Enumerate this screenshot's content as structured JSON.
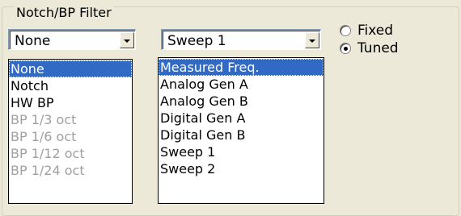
{
  "group": {
    "title": "Notch/BP Filter"
  },
  "filter_combo": {
    "value": "None"
  },
  "filter_dropdown": {
    "items": [
      {
        "label": "None",
        "selected": true,
        "enabled": true
      },
      {
        "label": "Notch",
        "selected": false,
        "enabled": true
      },
      {
        "label": "HW BP",
        "selected": false,
        "enabled": true
      },
      {
        "label": "BP 1/3 oct",
        "selected": false,
        "enabled": false
      },
      {
        "label": "BP 1/6 oct",
        "selected": false,
        "enabled": false
      },
      {
        "label": "BP 1/12 oct",
        "selected": false,
        "enabled": false
      },
      {
        "label": "BP 1/24 oct",
        "selected": false,
        "enabled": false
      }
    ]
  },
  "source_combo": {
    "value": "Sweep 1"
  },
  "source_dropdown": {
    "items": [
      {
        "label": "Measured Freq.",
        "selected": true
      },
      {
        "label": "Analog Gen A",
        "selected": false
      },
      {
        "label": "Analog Gen B",
        "selected": false
      },
      {
        "label": "Digital Gen A",
        "selected": false
      },
      {
        "label": "Digital Gen B",
        "selected": false
      },
      {
        "label": "Sweep 1",
        "selected": false
      },
      {
        "label": "Sweep 2",
        "selected": false
      }
    ]
  },
  "mode": {
    "options": [
      {
        "label": "Fixed",
        "checked": false
      },
      {
        "label": "Tuned",
        "checked": true
      }
    ]
  },
  "colors": {
    "selection": "#316ac5",
    "background": "#ece9d8",
    "disabled": "#a0a0a0"
  }
}
